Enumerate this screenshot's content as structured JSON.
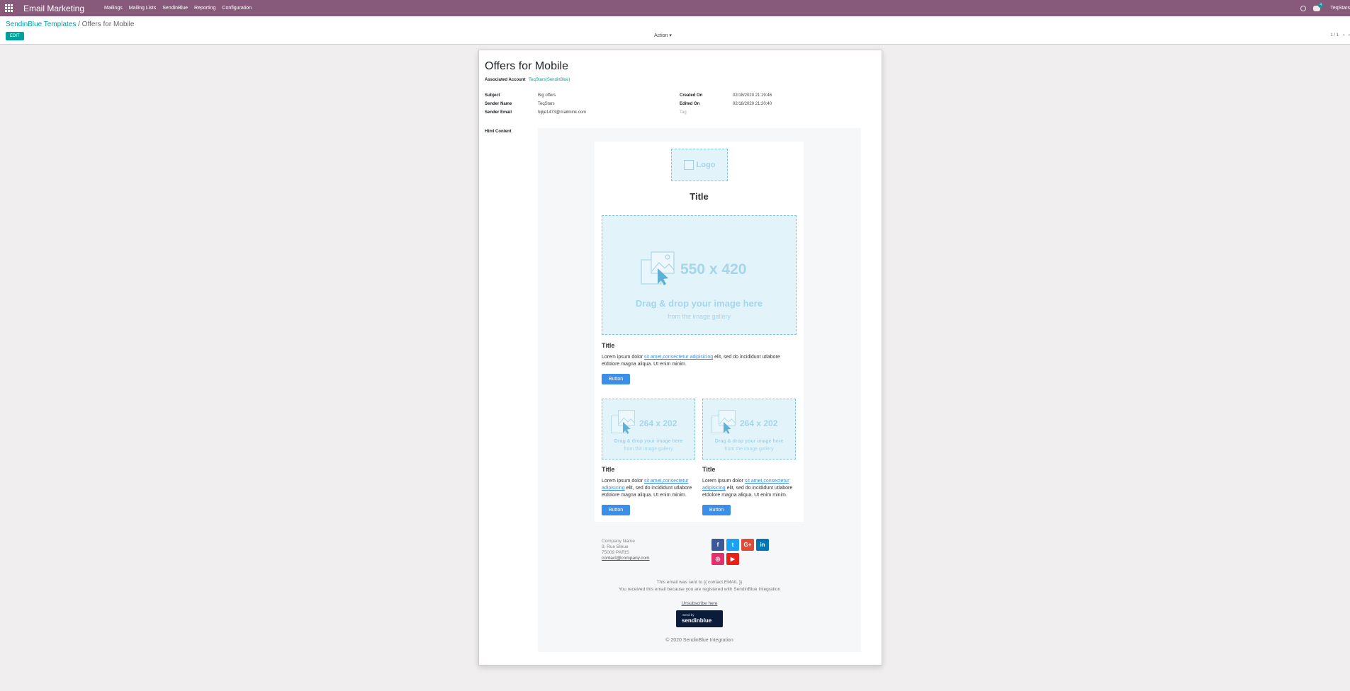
{
  "navbar": {
    "app_title": "Email Marketing",
    "menu": [
      "Mailings",
      "Mailing Lists",
      "SendinBlue",
      "Reporting",
      "Configuration"
    ],
    "chat_count": "4",
    "user": "TeqStars"
  },
  "control": {
    "breadcrumb_parent": "SendinBlue Templates",
    "breadcrumb_separator": "/",
    "breadcrumb_current": "Offers for Mobile",
    "edit_label": "EDIT",
    "action_label": "Action",
    "pager": "1 / 1"
  },
  "form": {
    "title": "Offers for Mobile",
    "associated_account_label": "Associated Account",
    "associated_account_value": "TeqStars(SendinBlue)",
    "subject_label": "Subject",
    "subject_value": "Big offers",
    "sender_name_label": "Sender Name",
    "sender_name_value": "TeqStars",
    "sender_email_label": "Sender Email",
    "sender_email_value": "hijije1473@mailmink.com",
    "created_on_label": "Created On",
    "created_on_value": "02/18/2020 21:19:46",
    "edited_on_label": "Edited On",
    "edited_on_value": "02/18/2020 21:20:40",
    "tag_placeholder": "Tag",
    "html_content_label": "Html Content"
  },
  "email": {
    "logo_text": "Logo",
    "main_title": "Title",
    "big_image_dim": "550 x 420",
    "drag_text": "Drag & drop your image here",
    "from_text": "from the image gallery",
    "section_title": "Title",
    "lorem_start": "Lorem ipsum dolor ",
    "lorem_link": "sit amet,consectetur adipisicing",
    "lorem_end": " elit, sed do incididunt utlabore etdolore magna aliqua. Ut enim minim.",
    "button_label": "Button",
    "small_image_dim": "264 x 202",
    "company_name": "Company Name",
    "address_line1": "9, Rue Bleue",
    "address_line2": "75009 PARIS",
    "contact_email": "contact@company.com",
    "socials": [
      "facebook",
      "twitter",
      "google-plus",
      "linkedin",
      "instagram",
      "youtube"
    ],
    "sent_to": "This email was sent to {{ contact.EMAIL }}",
    "received_because": "You received this email because you are registered with SendinBlue Integration",
    "unsubscribe": "Unsubscribe here",
    "badge_small": "Send by",
    "badge_brand": "sendinblue",
    "copyright": "© 2020 SendinBlue Integration"
  }
}
